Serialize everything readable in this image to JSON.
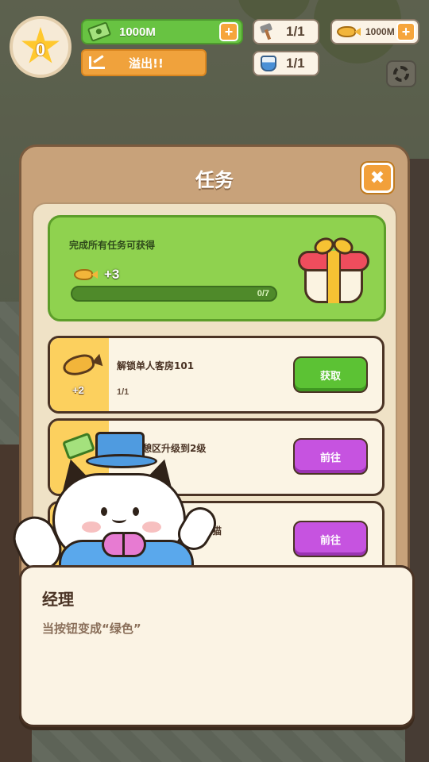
{
  "hud": {
    "level": "0",
    "cash": "1000M",
    "overflow_label": "溢出!!",
    "hammer_count": "1/1",
    "potion_count": "1/1",
    "fish_currency": "1000M"
  },
  "dialog": {
    "title": "任务",
    "reward_card": {
      "label": "完成所有任务可获得",
      "reward_amount": "+3",
      "progress_text": "0/7",
      "progress_value": 0,
      "progress_max": 7
    },
    "tasks": [
      {
        "icon": "fish-icon",
        "reward": "+2",
        "name": "解锁单人客房101",
        "count": "1/1",
        "button": "获取",
        "button_color": "#5cc234"
      },
      {
        "icon": "cash-icon",
        "reward": "",
        "name": "休憩区升级到2级",
        "count": "",
        "button": "前往",
        "button_color": "#c653e0"
      },
      {
        "icon": "",
        "reward": "",
        "name": "小猫",
        "count": "",
        "button": "前往",
        "button_color": "#c653e0"
      }
    ]
  },
  "speech": {
    "speaker": "经理",
    "text": "当按钮变成“绿色”"
  },
  "colors": {
    "accent_orange": "#f2a03a",
    "green": "#68c342",
    "purple": "#c653e0",
    "panel": "#c8a27a"
  }
}
